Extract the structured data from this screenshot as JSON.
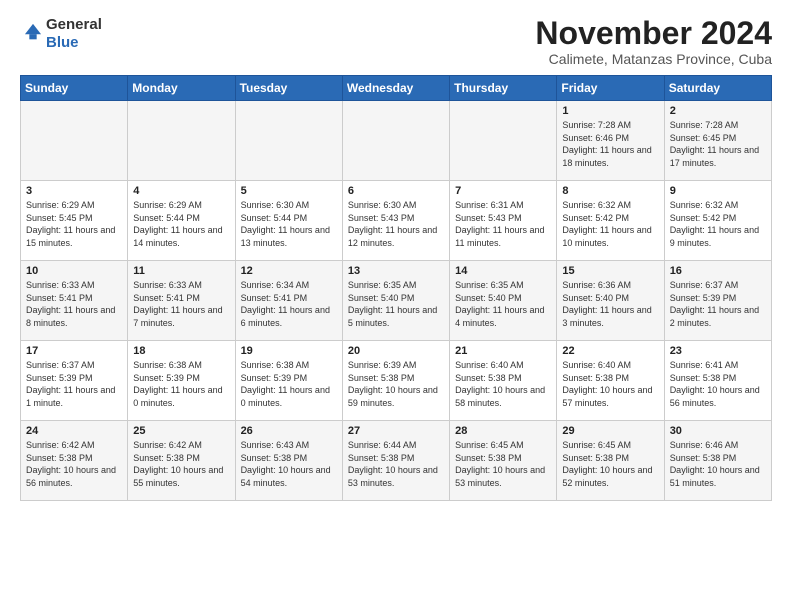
{
  "logo": {
    "general": "General",
    "blue": "Blue"
  },
  "header": {
    "title": "November 2024",
    "subtitle": "Calimete, Matanzas Province, Cuba"
  },
  "weekdays": [
    "Sunday",
    "Monday",
    "Tuesday",
    "Wednesday",
    "Thursday",
    "Friday",
    "Saturday"
  ],
  "weeks": [
    [
      {
        "day": "",
        "content": ""
      },
      {
        "day": "",
        "content": ""
      },
      {
        "day": "",
        "content": ""
      },
      {
        "day": "",
        "content": ""
      },
      {
        "day": "",
        "content": ""
      },
      {
        "day": "1",
        "content": "Sunrise: 7:28 AM\nSunset: 6:46 PM\nDaylight: 11 hours and 18 minutes."
      },
      {
        "day": "2",
        "content": "Sunrise: 7:28 AM\nSunset: 6:45 PM\nDaylight: 11 hours and 17 minutes."
      }
    ],
    [
      {
        "day": "3",
        "content": "Sunrise: 6:29 AM\nSunset: 5:45 PM\nDaylight: 11 hours and 15 minutes."
      },
      {
        "day": "4",
        "content": "Sunrise: 6:29 AM\nSunset: 5:44 PM\nDaylight: 11 hours and 14 minutes."
      },
      {
        "day": "5",
        "content": "Sunrise: 6:30 AM\nSunset: 5:44 PM\nDaylight: 11 hours and 13 minutes."
      },
      {
        "day": "6",
        "content": "Sunrise: 6:30 AM\nSunset: 5:43 PM\nDaylight: 11 hours and 12 minutes."
      },
      {
        "day": "7",
        "content": "Sunrise: 6:31 AM\nSunset: 5:43 PM\nDaylight: 11 hours and 11 minutes."
      },
      {
        "day": "8",
        "content": "Sunrise: 6:32 AM\nSunset: 5:42 PM\nDaylight: 11 hours and 10 minutes."
      },
      {
        "day": "9",
        "content": "Sunrise: 6:32 AM\nSunset: 5:42 PM\nDaylight: 11 hours and 9 minutes."
      }
    ],
    [
      {
        "day": "10",
        "content": "Sunrise: 6:33 AM\nSunset: 5:41 PM\nDaylight: 11 hours and 8 minutes."
      },
      {
        "day": "11",
        "content": "Sunrise: 6:33 AM\nSunset: 5:41 PM\nDaylight: 11 hours and 7 minutes."
      },
      {
        "day": "12",
        "content": "Sunrise: 6:34 AM\nSunset: 5:41 PM\nDaylight: 11 hours and 6 minutes."
      },
      {
        "day": "13",
        "content": "Sunrise: 6:35 AM\nSunset: 5:40 PM\nDaylight: 11 hours and 5 minutes."
      },
      {
        "day": "14",
        "content": "Sunrise: 6:35 AM\nSunset: 5:40 PM\nDaylight: 11 hours and 4 minutes."
      },
      {
        "day": "15",
        "content": "Sunrise: 6:36 AM\nSunset: 5:40 PM\nDaylight: 11 hours and 3 minutes."
      },
      {
        "day": "16",
        "content": "Sunrise: 6:37 AM\nSunset: 5:39 PM\nDaylight: 11 hours and 2 minutes."
      }
    ],
    [
      {
        "day": "17",
        "content": "Sunrise: 6:37 AM\nSunset: 5:39 PM\nDaylight: 11 hours and 1 minute."
      },
      {
        "day": "18",
        "content": "Sunrise: 6:38 AM\nSunset: 5:39 PM\nDaylight: 11 hours and 0 minutes."
      },
      {
        "day": "19",
        "content": "Sunrise: 6:38 AM\nSunset: 5:39 PM\nDaylight: 11 hours and 0 minutes."
      },
      {
        "day": "20",
        "content": "Sunrise: 6:39 AM\nSunset: 5:38 PM\nDaylight: 10 hours and 59 minutes."
      },
      {
        "day": "21",
        "content": "Sunrise: 6:40 AM\nSunset: 5:38 PM\nDaylight: 10 hours and 58 minutes."
      },
      {
        "day": "22",
        "content": "Sunrise: 6:40 AM\nSunset: 5:38 PM\nDaylight: 10 hours and 57 minutes."
      },
      {
        "day": "23",
        "content": "Sunrise: 6:41 AM\nSunset: 5:38 PM\nDaylight: 10 hours and 56 minutes."
      }
    ],
    [
      {
        "day": "24",
        "content": "Sunrise: 6:42 AM\nSunset: 5:38 PM\nDaylight: 10 hours and 56 minutes."
      },
      {
        "day": "25",
        "content": "Sunrise: 6:42 AM\nSunset: 5:38 PM\nDaylight: 10 hours and 55 minutes."
      },
      {
        "day": "26",
        "content": "Sunrise: 6:43 AM\nSunset: 5:38 PM\nDaylight: 10 hours and 54 minutes."
      },
      {
        "day": "27",
        "content": "Sunrise: 6:44 AM\nSunset: 5:38 PM\nDaylight: 10 hours and 53 minutes."
      },
      {
        "day": "28",
        "content": "Sunrise: 6:45 AM\nSunset: 5:38 PM\nDaylight: 10 hours and 53 minutes."
      },
      {
        "day": "29",
        "content": "Sunrise: 6:45 AM\nSunset: 5:38 PM\nDaylight: 10 hours and 52 minutes."
      },
      {
        "day": "30",
        "content": "Sunrise: 6:46 AM\nSunset: 5:38 PM\nDaylight: 10 hours and 51 minutes."
      }
    ]
  ]
}
